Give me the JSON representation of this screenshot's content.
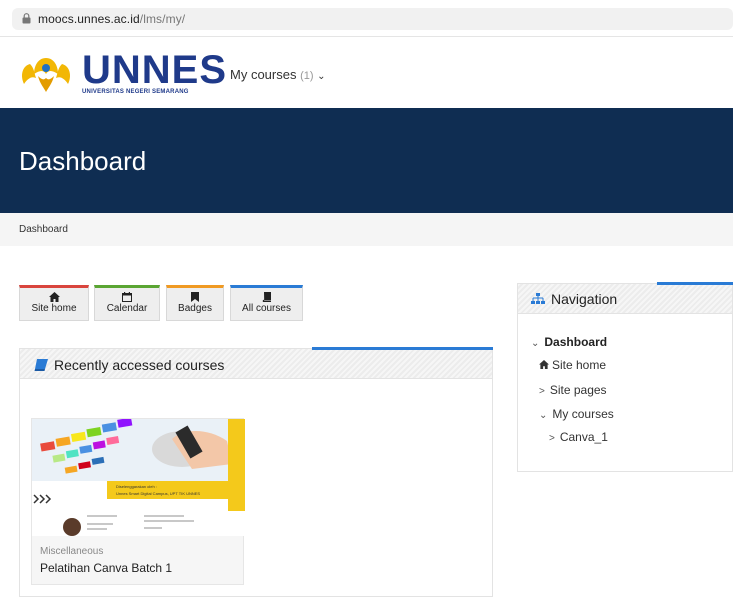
{
  "browser": {
    "url_host": "moocs.unnes.ac.id",
    "url_path": "/lms/my/"
  },
  "header": {
    "logo_text": "UNNES",
    "logo_subtitle": "UNIVERSITAS NEGERI SEMARANG",
    "mycourses_label": "My courses",
    "mycourses_count": "(1)"
  },
  "page": {
    "title": "Dashboard",
    "breadcrumb": "Dashboard"
  },
  "quicklinks": [
    {
      "label": "Site home",
      "icon": "home-icon",
      "color": "#d9453d"
    },
    {
      "label": "Calendar",
      "icon": "calendar-icon",
      "color": "#5aa532"
    },
    {
      "label": "Badges",
      "icon": "bookmark-icon",
      "color": "#f09a23"
    },
    {
      "label": "All courses",
      "icon": "book-icon",
      "color": "#2a7bd5"
    }
  ],
  "recent": {
    "title": "Recently accessed courses",
    "course": {
      "category": "Miscellaneous",
      "name": "Pelatihan Canva Batch 1",
      "image_caption_line1": "Diselenggarakan oleh :",
      "image_caption_line2": "Unnes Smart Digital Campus, UPT TIK UNNES"
    }
  },
  "navigation": {
    "title": "Navigation",
    "items": [
      {
        "label": "Dashboard",
        "prefix": "⌄"
      },
      {
        "label": "Site home",
        "prefix": "home"
      },
      {
        "label": "Site pages",
        "prefix": ">"
      },
      {
        "label": "My courses",
        "prefix": "⌄"
      },
      {
        "label": "Canva_1",
        "prefix": ">"
      }
    ]
  },
  "colors": {
    "banner": "#0f2d52",
    "accent": "#2a7bd5",
    "logo_blue": "#1f3a8a"
  }
}
